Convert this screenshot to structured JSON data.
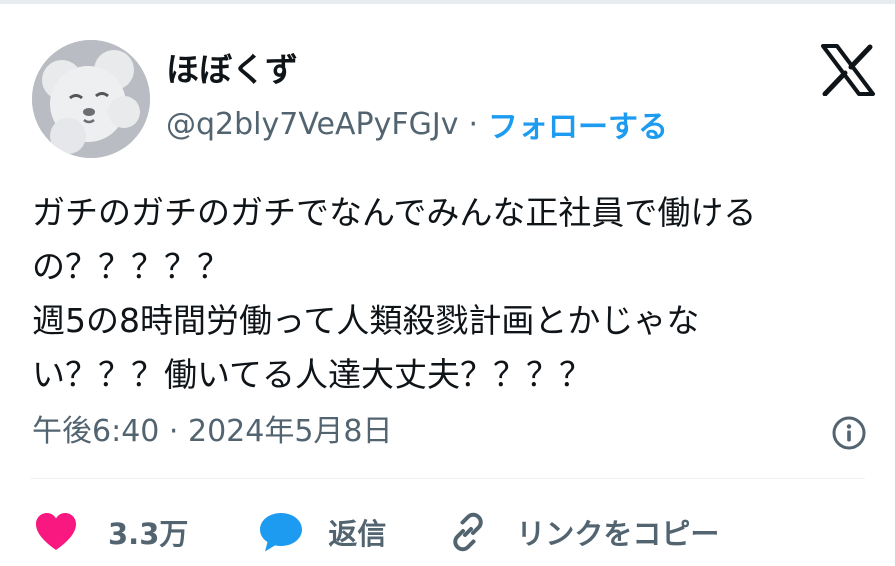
{
  "user": {
    "display_name": "ほぼくず",
    "handle": "@q2bly7VeAPyFGJv",
    "separator": "·",
    "follow_label": "フォローする",
    "avatar_icon": "bear-avatar"
  },
  "brand": {
    "logo_icon": "x-logo-icon"
  },
  "tweet": {
    "text": "ガチのガチのガチでなんでみんな正社員で働ける\nの？？？？？\n週5の8時間労働って人類殺戮計画とかじゃな\nい？？？働いてる人達大丈夫？？？？",
    "timestamp": "午後6:40 · 2024年5月8日"
  },
  "actions": {
    "like_count": "3.3万",
    "reply_label": "返信",
    "copy_link_label": "リンクをコピー"
  },
  "colors": {
    "accent": "#1d9bf0",
    "like": "#f91880",
    "secondary_text": "#536471",
    "text": "#0f1419"
  }
}
